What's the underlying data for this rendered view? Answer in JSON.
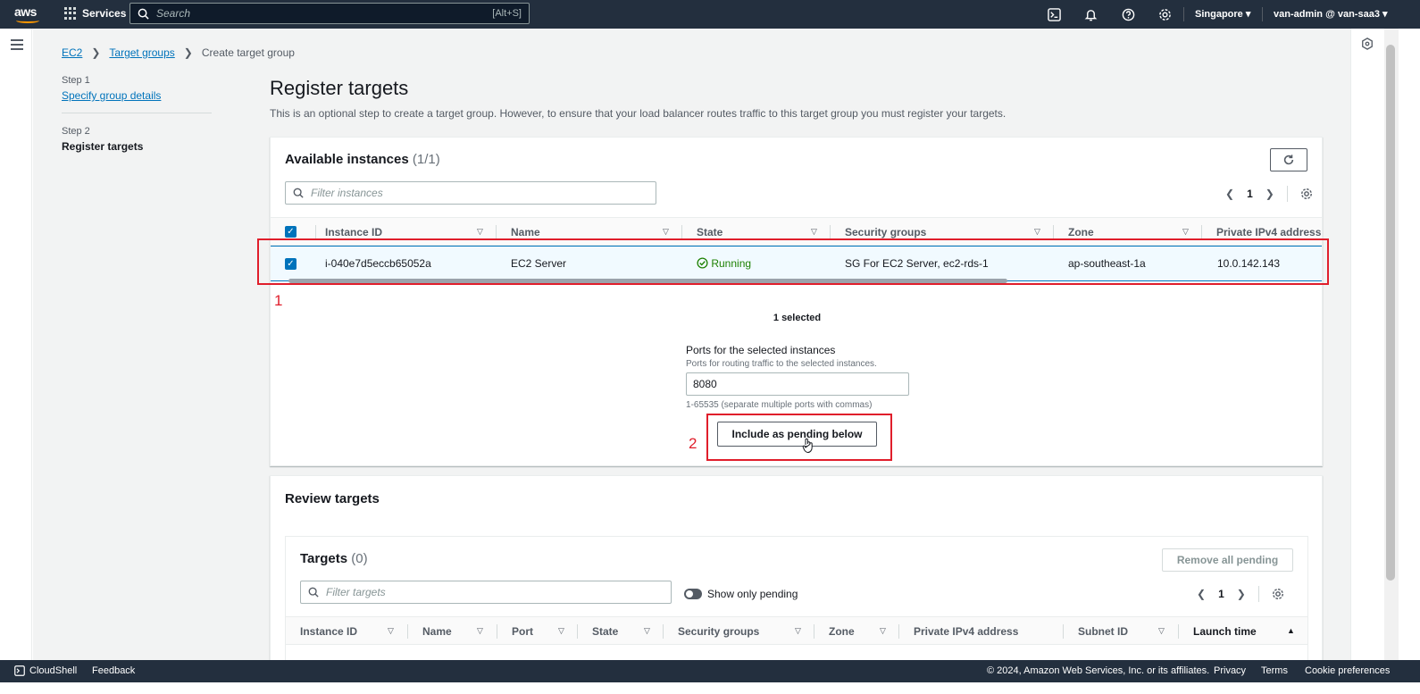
{
  "nav": {
    "logo": "aws",
    "services": "Services",
    "search_placeholder": "Search",
    "search_shortcut": "[Alt+S]",
    "region": "Singapore ▾",
    "account": "van-admin @ van-saa3 ▾"
  },
  "breadcrumb": {
    "ec2": "EC2",
    "target_groups": "Target groups",
    "current": "Create target group"
  },
  "steps": {
    "step1_label": "Step 1",
    "step1_link": "Specify group details",
    "step2_label": "Step 2",
    "step2_current": "Register targets"
  },
  "page": {
    "title": "Register targets",
    "description": "This is an optional step to create a target group. However, to ensure that your load balancer routes traffic to this target group you must register your targets."
  },
  "available": {
    "title": "Available instances",
    "count": "(1/1)",
    "filter_placeholder": "Filter instances",
    "page": "1",
    "columns": [
      "Instance ID",
      "Name",
      "State",
      "Security groups",
      "Zone",
      "Private IPv4 address"
    ],
    "row": {
      "instance_id": "i-040e7d5eccb65052a",
      "name": "EC2 Server",
      "state": "Running",
      "security_groups": "SG For EC2 Server, ec2-rds-1",
      "zone": "ap-southeast-1a",
      "ipv4": "10.0.142.143"
    },
    "selected_text": "1 selected",
    "ports_label": "Ports for the selected instances",
    "ports_desc": "Ports for routing traffic to the selected instances.",
    "ports_value": "8080",
    "ports_hint": "1-65535 (separate multiple ports with commas)",
    "include_button": "Include as pending below"
  },
  "annotations": {
    "one": "1",
    "two": "2"
  },
  "review": {
    "title": "Review targets",
    "targets_title": "Targets",
    "targets_count": "(0)",
    "remove_button": "Remove all pending",
    "filter_placeholder": "Filter targets",
    "toggle_label": "Show only pending",
    "page": "1",
    "columns": [
      "Instance ID",
      "Name",
      "Port",
      "State",
      "Security groups",
      "Zone",
      "Private IPv4 address",
      "Subnet ID",
      "Launch time"
    ]
  },
  "footer": {
    "cloudshell": "CloudShell",
    "feedback": "Feedback",
    "copyright": "© 2024, Amazon Web Services, Inc. or its affiliates.",
    "privacy": "Privacy",
    "terms": "Terms",
    "cookies": "Cookie preferences"
  },
  "colors": {
    "nav_bg": "#232f3e",
    "link": "#0073bb",
    "running": "#1d8102",
    "annotation": "#e01e2b",
    "brand_orange": "#ff9900"
  }
}
